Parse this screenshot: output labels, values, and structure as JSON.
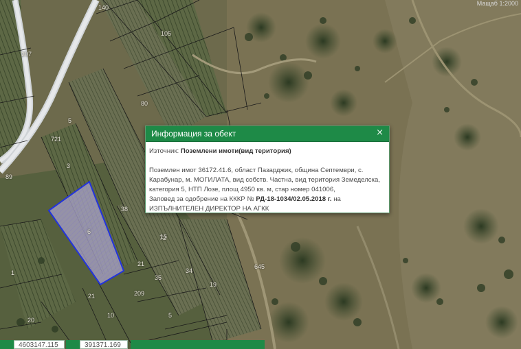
{
  "map": {
    "scale_text": "Мащаб 1:2000",
    "parcel_labels": [
      "140",
      "105",
      "207",
      "80",
      "5",
      "89",
      "721",
      "3",
      "6",
      "38",
      "15",
      "21",
      "35",
      "34",
      "21",
      "19",
      "209",
      "20",
      "10",
      "1",
      "5",
      "72",
      "645"
    ],
    "colors": {
      "parcel_boundary": "#1a1a1a",
      "selected_parcel_stroke": "#2233dd",
      "selected_parcel_fill": "#a9a2c9",
      "road": "#d9dcdf"
    }
  },
  "popup": {
    "title": "Информация за обект",
    "close_icon": "close-icon",
    "source_label": "Източник:",
    "source_value": "Поземлени имоти(вид територия)",
    "line1": "Поземлен имот 36172.41.6, област Пазарджик, община Септември, с.",
    "line2": "Карабунар, м. МОГИЛАТА, вид собств. Частна, вид територия Земеделска,",
    "line3": "категория 5, НТП Лозе, площ 4950 кв. м, стар номер 041006,",
    "line4_prefix": "Заповед за одобрение на КККР №",
    "line4_bold": "РД-18-1034/02.05.2018 г.",
    "line4_suffix": "на",
    "line5": "ИЗПЪЛНИТЕЛЕН ДИРЕКТОР НА АГКК",
    "header_color": "#1e8a47"
  },
  "bottom_bar": {
    "coord_x": "4603147.115",
    "coord_y": "391371.169"
  }
}
